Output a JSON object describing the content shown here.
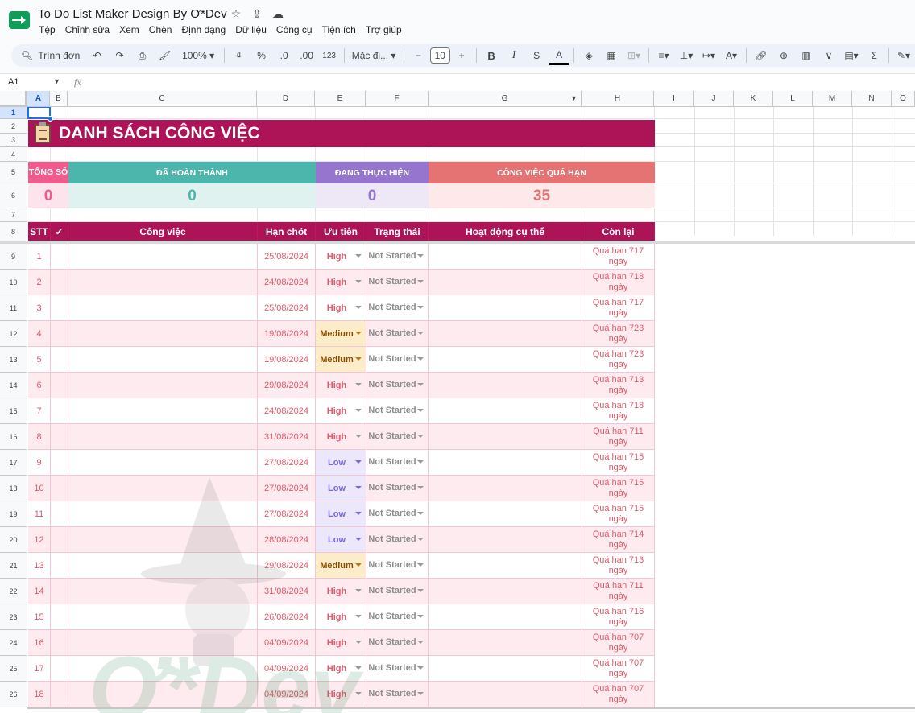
{
  "titlebar": {
    "doc_title": "To Do List Maker Design By Ơ*Dev",
    "icons": [
      "star-icon",
      "move-to-folder-icon",
      "cloud-status-icon"
    ]
  },
  "menu": [
    "Tệp",
    "Chỉnh sửa",
    "Xem",
    "Chèn",
    "Định dạng",
    "Dữ liệu",
    "Công cụ",
    "Tiện ích",
    "Trợ giúp"
  ],
  "toolbar": {
    "search_label": "Trình đơn",
    "zoom": "100%",
    "currency": "₫",
    "percent": "%",
    "decrease_decimal": ".0",
    "increase_decimal": ".00",
    "number_format": "123",
    "font": "Mặc đị...",
    "font_size": "10",
    "bold": "B",
    "italic": "I",
    "strike": "S",
    "text_color": "A",
    "sum": "Σ"
  },
  "formula_bar": {
    "name_box": "A1",
    "fx": "fx",
    "value": ""
  },
  "columns": [
    "A",
    "B",
    "C",
    "D",
    "E",
    "F",
    "G",
    "H",
    "I",
    "J",
    "K",
    "L",
    "M",
    "N",
    "O"
  ],
  "row_numbers": [
    "1",
    "2",
    "3",
    "4",
    "5",
    "6",
    "7",
    "8",
    "9",
    "10",
    "11",
    "12",
    "13",
    "14",
    "15",
    "16",
    "17",
    "18",
    "19",
    "20",
    "21",
    "22",
    "23",
    "24",
    "25",
    "26"
  ],
  "sheet": {
    "title": "DANH SÁCH CÔNG VIỆC",
    "stats": {
      "total_label": "TỔNG SỐ",
      "total_value": "0",
      "done_label": "ĐÃ HOÀN THÀNH",
      "done_value": "0",
      "inprogress_label": "ĐANG THỰC HIỆN",
      "inprogress_value": "0",
      "overdue_label": "CÔNG VIỆC QUÁ HẠN",
      "overdue_value": "35"
    },
    "headers": {
      "stt": "STT",
      "check": "✓",
      "task": "Công việc",
      "deadline": "Hạn chót",
      "priority": "Ưu tiên",
      "status": "Trạng thái",
      "activity": "Hoạt động cụ thể",
      "remaining": "Còn lại"
    },
    "tasks": [
      {
        "stt": "1",
        "deadline": "25/08/2024",
        "priority": "High",
        "status": "Not Started",
        "remaining": "Quá hạn 717 ngày"
      },
      {
        "stt": "2",
        "deadline": "24/08/2024",
        "priority": "High",
        "status": "Not Started",
        "remaining": "Quá hạn 718 ngày"
      },
      {
        "stt": "3",
        "deadline": "25/08/2024",
        "priority": "High",
        "status": "Not Started",
        "remaining": "Quá hạn 717 ngày"
      },
      {
        "stt": "4",
        "deadline": "19/08/2024",
        "priority": "Medium",
        "status": "Not Started",
        "remaining": "Quá hạn 723 ngày"
      },
      {
        "stt": "5",
        "deadline": "19/08/2024",
        "priority": "Medium",
        "status": "Not Started",
        "remaining": "Quá hạn 723 ngày"
      },
      {
        "stt": "6",
        "deadline": "29/08/2024",
        "priority": "High",
        "status": "Not Started",
        "remaining": "Quá hạn 713 ngày"
      },
      {
        "stt": "7",
        "deadline": "24/08/2024",
        "priority": "High",
        "status": "Not Started",
        "remaining": "Quá hạn 718 ngày"
      },
      {
        "stt": "8",
        "deadline": "31/08/2024",
        "priority": "High",
        "status": "Not Started",
        "remaining": "Quá hạn 711 ngày"
      },
      {
        "stt": "9",
        "deadline": "27/08/2024",
        "priority": "Low",
        "status": "Not Started",
        "remaining": "Quá hạn 715 ngày"
      },
      {
        "stt": "10",
        "deadline": "27/08/2024",
        "priority": "Low",
        "status": "Not Started",
        "remaining": "Quá hạn 715 ngày"
      },
      {
        "stt": "11",
        "deadline": "27/08/2024",
        "priority": "Low",
        "status": "Not Started",
        "remaining": "Quá hạn 715 ngày"
      },
      {
        "stt": "12",
        "deadline": "28/08/2024",
        "priority": "Low",
        "status": "Not Started",
        "remaining": "Quá hạn 714 ngày"
      },
      {
        "stt": "13",
        "deadline": "29/08/2024",
        "priority": "Medium",
        "status": "Not Started",
        "remaining": "Quá hạn 713 ngày"
      },
      {
        "stt": "14",
        "deadline": "31/08/2024",
        "priority": "High",
        "status": "Not Started",
        "remaining": "Quá hạn 711 ngày"
      },
      {
        "stt": "15",
        "deadline": "26/08/2024",
        "priority": "High",
        "status": "Not Started",
        "remaining": "Quá hạn 716 ngày"
      },
      {
        "stt": "16",
        "deadline": "04/09/2024",
        "priority": "High",
        "status": "Not Started",
        "remaining": "Quá hạn 707 ngày"
      },
      {
        "stt": "17",
        "deadline": "04/09/2024",
        "priority": "High",
        "status": "Not Started",
        "remaining": "Quá hạn 707 ngày"
      },
      {
        "stt": "18",
        "deadline": "04/09/2024",
        "priority": "High",
        "status": "Not Started",
        "remaining": "Quá hạn 707 ngày"
      }
    ]
  },
  "watermark": {
    "text": "Ơ*Dev"
  },
  "colors": {
    "banner": "#ad1457",
    "total": "#ef5b8c",
    "done": "#4db6ac",
    "inprogress": "#9575cd",
    "overdue": "#e57373"
  }
}
